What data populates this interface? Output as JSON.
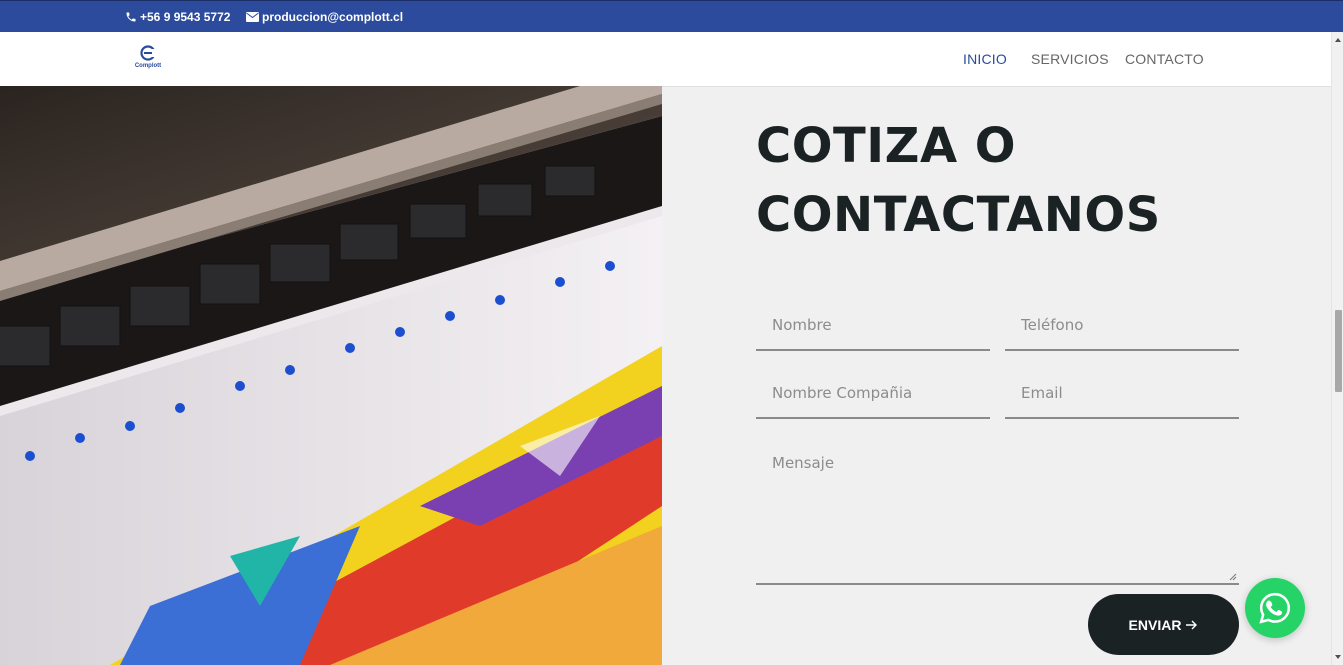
{
  "topbar": {
    "phone": "+56 9 9543 5772",
    "email": "produccion@complott.cl",
    "phone_icon": "phone-icon",
    "email_icon": "mail-icon"
  },
  "header": {
    "logo_text": "Complott",
    "nav": [
      {
        "label": "INICIO",
        "active": true
      },
      {
        "label": "SERVICIOS",
        "active": false
      },
      {
        "label": "CONTACTO",
        "active": false
      }
    ]
  },
  "contact": {
    "title_line1": "COTIZA O",
    "title_line2": "CONTACTANOS",
    "fields": {
      "nombre": {
        "placeholder": "Nombre",
        "value": ""
      },
      "telefono": {
        "placeholder": "Teléfono",
        "value": ""
      },
      "compania": {
        "placeholder": "Nombre Compañia",
        "value": ""
      },
      "email": {
        "placeholder": "Email",
        "value": ""
      },
      "mensaje": {
        "placeholder": "Mensaje",
        "value": ""
      }
    },
    "submit_label": "ENVIAR",
    "submit_icon": "arrow-right-icon"
  },
  "floating": {
    "icon": "whatsapp-icon"
  },
  "colors": {
    "brand_blue": "#2c4b9c",
    "dark": "#1b2224",
    "whatsapp": "#25d366",
    "background": "#f0f0f0"
  }
}
